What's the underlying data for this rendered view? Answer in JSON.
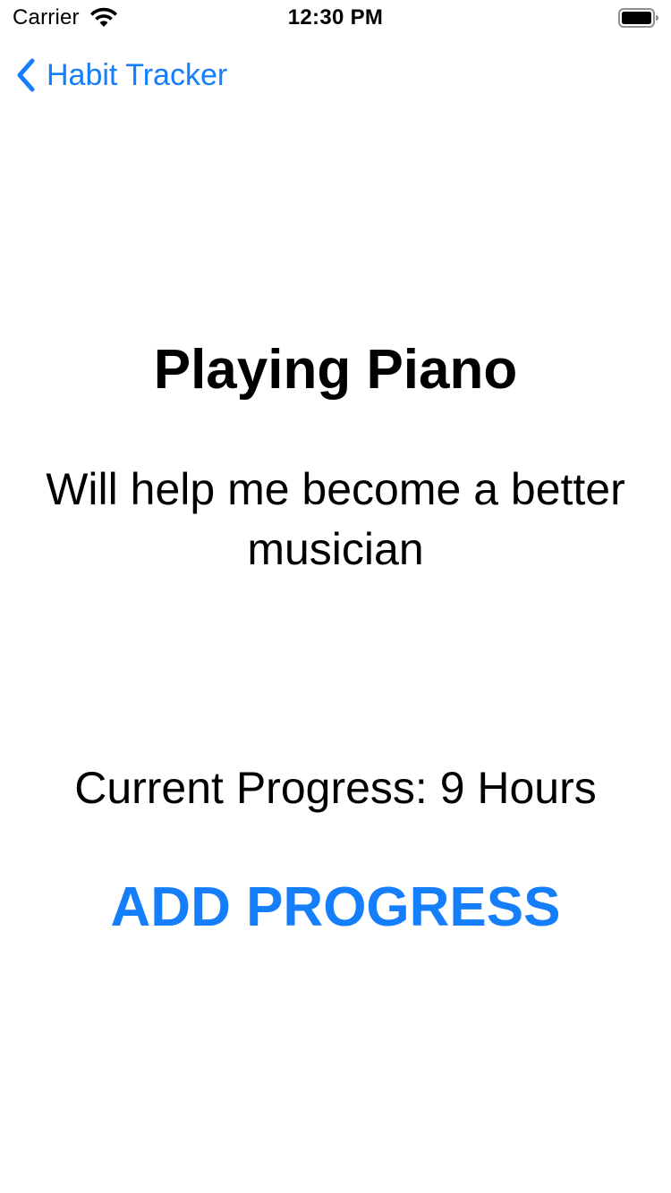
{
  "status_bar": {
    "carrier": "Carrier",
    "time": "12:30 PM",
    "wifi_icon": "wifi-icon",
    "battery_icon": "battery-full-icon"
  },
  "nav": {
    "back_label": "Habit Tracker",
    "back_icon": "chevron-left-icon"
  },
  "habit": {
    "title": "Playing Piano",
    "description": "Will help me become a better musician",
    "progress_text": "Current Progress: 9 Hours"
  },
  "actions": {
    "add_progress_label": "ADD PROGRESS"
  },
  "colors": {
    "accent": "#147EFB",
    "text": "#000000",
    "background": "#FFFFFF"
  }
}
